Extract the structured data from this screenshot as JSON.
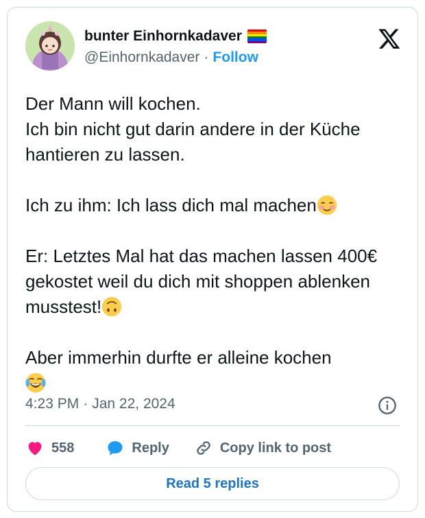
{
  "author": {
    "display_name": "bunter Einhornkadaver",
    "handle": "@Einhornkadaver",
    "separator": "·",
    "follow_label": "Follow",
    "flag_icon": "rainbow-flag-icon",
    "flag_colors": [
      "#e40303",
      "#ff8c00",
      "#ffed00",
      "#008026",
      "#004dff",
      "#750787"
    ]
  },
  "tweet": {
    "text": "Der Mann will kochen.\nIch bin nicht gut darin andere in der Küche hantieren zu lassen.\n\nIch zu ihm: Ich lass dich mal machen",
    "text_part2": "\n\nEr: Letztes Mal hat das machen lassen 400€ gekostet weil du dich mit shoppen ablenken musstest!",
    "text_part3": "\n\nAber immerhin durfte er alleine kochen\n",
    "emojis": [
      "smiling-face-icon",
      "upside-down-face-icon",
      "tears-of-joy-icon"
    ]
  },
  "meta": {
    "time": "4:23 PM",
    "separator": "·",
    "date": "Jan 22, 2024"
  },
  "actions": {
    "like_count": "558",
    "reply_label": "Reply",
    "copy_label": "Copy link to post"
  },
  "footer": {
    "read_replies_label": "Read 5 replies"
  },
  "colors": {
    "accent": "#1d9bf0",
    "heart": "#f91880",
    "reply_bubble": "#1d9bf0",
    "muted": "#536471",
    "border": "#cfd9de"
  }
}
